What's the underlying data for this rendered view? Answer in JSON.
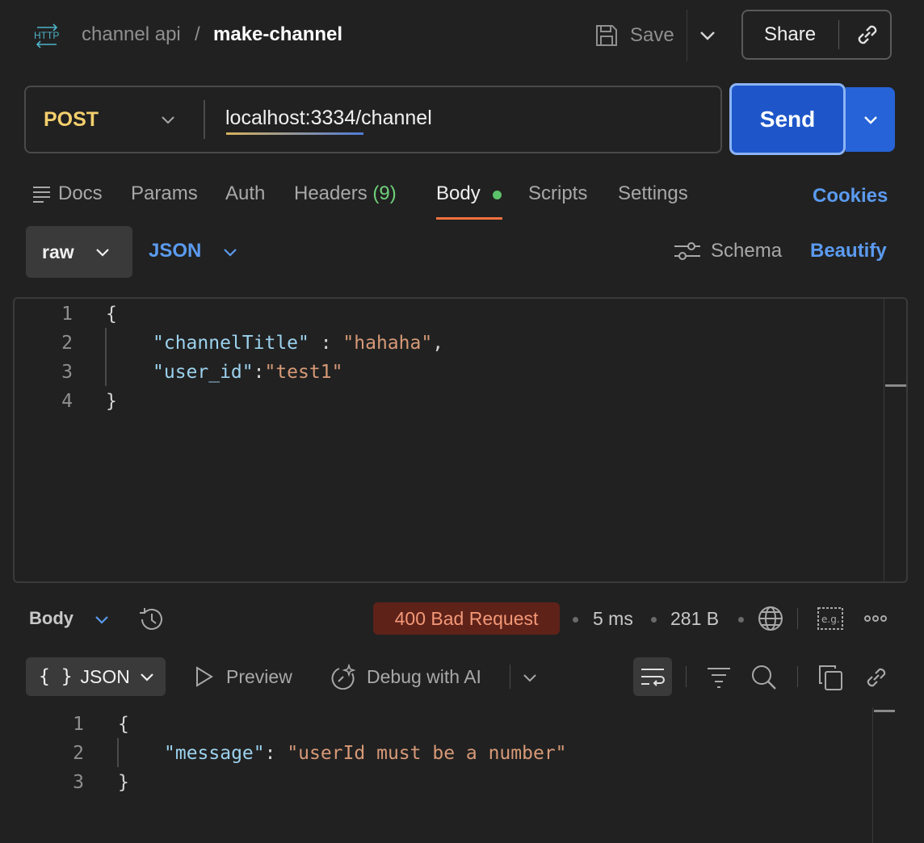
{
  "header": {
    "protocol_icon": "http-icon",
    "collection": "channel api",
    "separator": "/",
    "request_name": "make-channel",
    "save_label": "Save",
    "share_label": "Share"
  },
  "request": {
    "method": "POST",
    "url": "localhost:3334/channel",
    "send_label": "Send"
  },
  "tabs": {
    "docs": "Docs",
    "params": "Params",
    "auth": "Auth",
    "headers": "Headers",
    "headers_count": "(9)",
    "body": "Body",
    "scripts": "Scripts",
    "settings": "Settings",
    "active": "Body",
    "cookies": "Cookies"
  },
  "body_options": {
    "mode": "raw",
    "language": "JSON",
    "schema_label": "Schema",
    "beautify_label": "Beautify"
  },
  "request_body": {
    "line_numbers": [
      "1",
      "2",
      "3",
      "4"
    ],
    "open_brace": "{",
    "key1": "\"channelTitle\"",
    "sep1": " : ",
    "val1": "\"hahaha\"",
    "comma1": ",",
    "key2": "\"user_id\"",
    "sep2": ":",
    "val2": "\"test1\"",
    "close_brace": "}"
  },
  "response": {
    "view_label": "Body",
    "status": "400 Bad Request",
    "time": "5 ms",
    "size": "281 B",
    "format_braces": "{ }",
    "format_label": "JSON",
    "preview_label": "Preview",
    "debug_label": "Debug with AI",
    "line_numbers": [
      "1",
      "2",
      "3"
    ],
    "open_brace": "{",
    "key": "\"message\"",
    "sep": ": ",
    "value": "\"userId must be a number\"",
    "close_brace": "}"
  },
  "colors": {
    "background": "#212121",
    "accent_blue": "#5b9bf0",
    "send_blue": "#1e56c9",
    "method_yellow": "#f3cf6c",
    "tab_active_underline": "#f37240",
    "error_badge_bg": "#5e2219",
    "error_badge_text": "#f39877",
    "json_key": "#9cd2ee",
    "json_string": "#d79977"
  }
}
